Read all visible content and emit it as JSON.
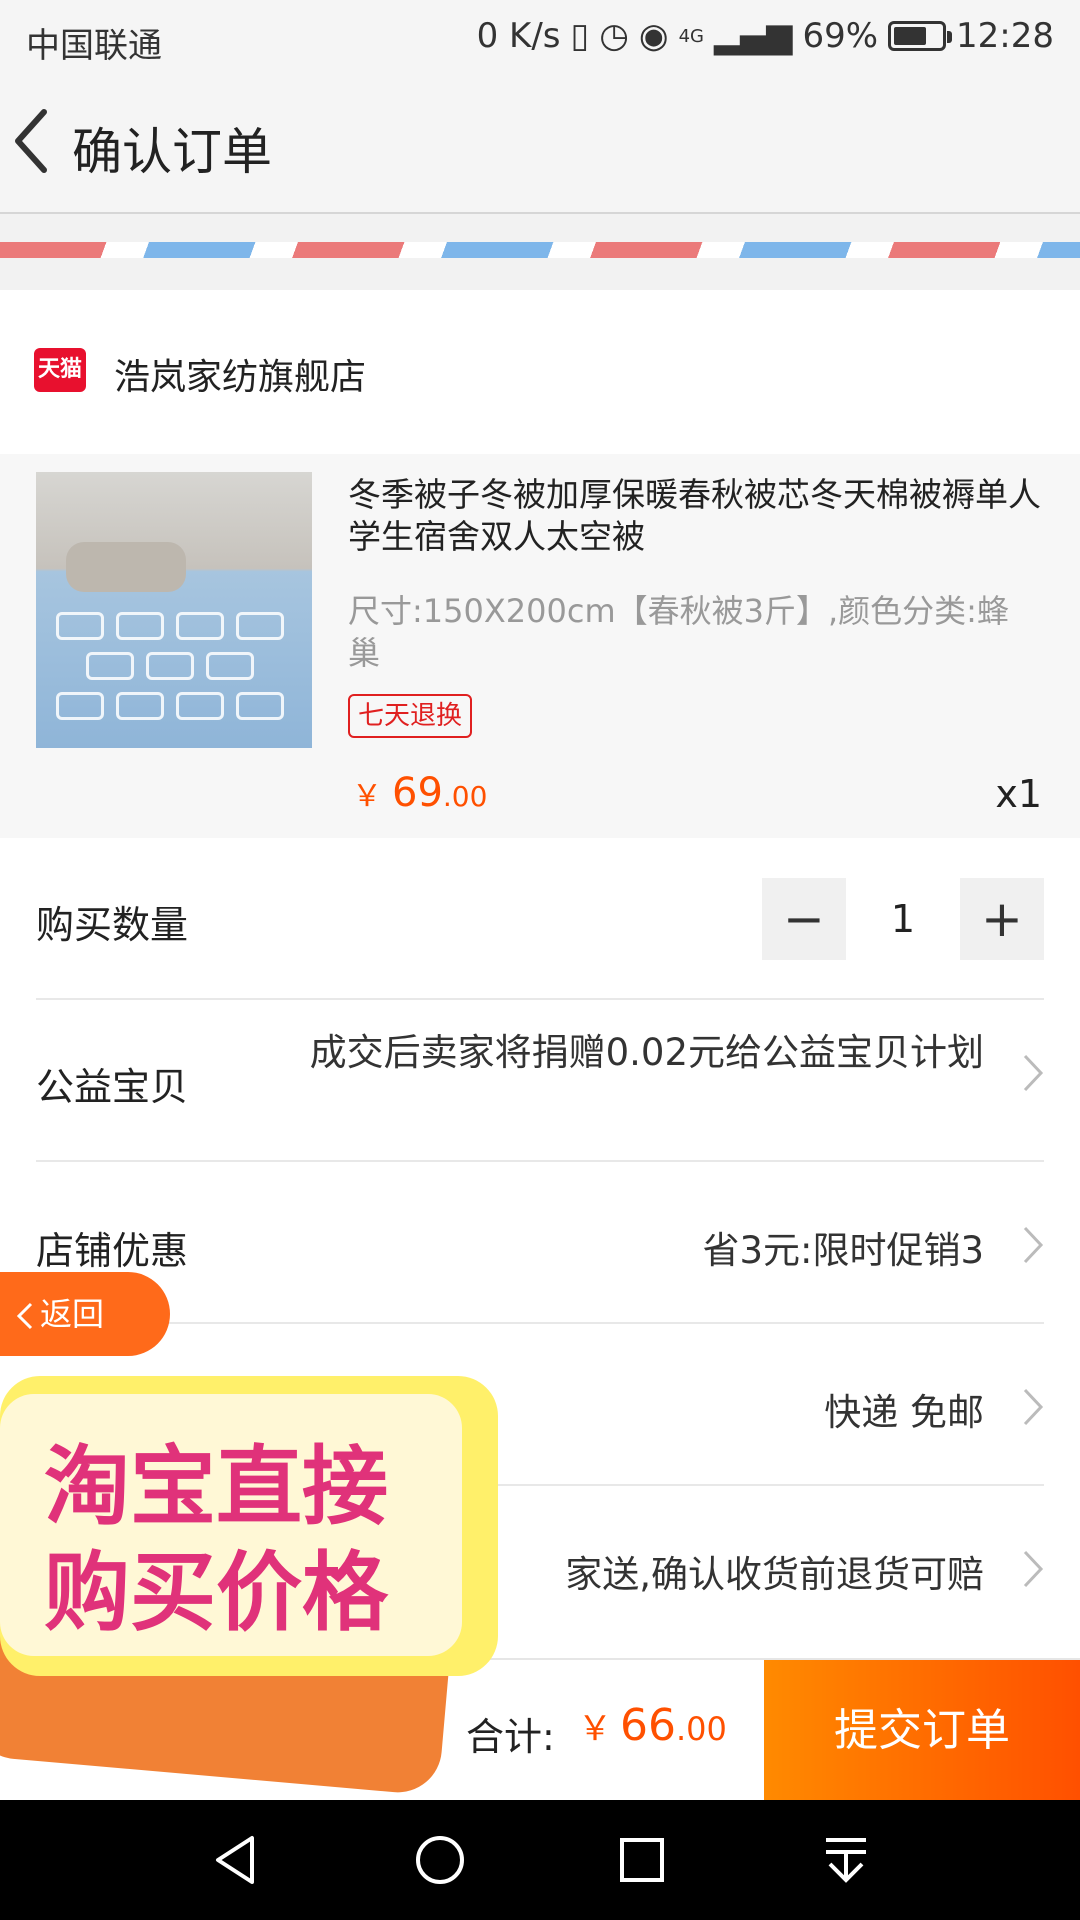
{
  "status_bar": {
    "carrier": "中国联通",
    "speed": "0 K/s",
    "network": "4G",
    "battery": "69%",
    "time": "12:28",
    "battery_level": 0.69
  },
  "nav": {
    "title": "确认订单"
  },
  "shop": {
    "logo": "天猫",
    "name": "浩岚家纺旗舰店"
  },
  "product": {
    "title": "冬季被子冬被加厚保暖春秋被芯冬天棉被褥单人学生宿舍双人太空被",
    "spec": "尺寸:150X200cm【春秋被3斤】,颜色分类:蜂巢",
    "badge": "七天退换",
    "price_currency": "￥",
    "price_int": "69",
    "price_dec": ".00",
    "qty": "x1"
  },
  "options": {
    "quantity_label": "购买数量",
    "quantity_value": "1",
    "minus": "−",
    "plus": "+",
    "charity_label": "公益宝贝",
    "charity_value": "成交后卖家将捐赠0.02元给公益宝贝计划",
    "discount_label": "店铺优惠",
    "discount_value": "省3元:限时促销3",
    "shipping_value": "快递 免邮",
    "insurance_value": "家送,确认收货前退货可赔"
  },
  "footer": {
    "total_label": "合计:",
    "total_currency": "￥",
    "total_int": "66",
    "total_dec": ".00",
    "submit_label": "提交订单"
  },
  "overlay": {
    "back_label": "返回",
    "promo_text": "淘宝直接购买价格"
  },
  "icons": {
    "back": "chevron-left-icon",
    "chevron": "chevron-right-icon"
  }
}
